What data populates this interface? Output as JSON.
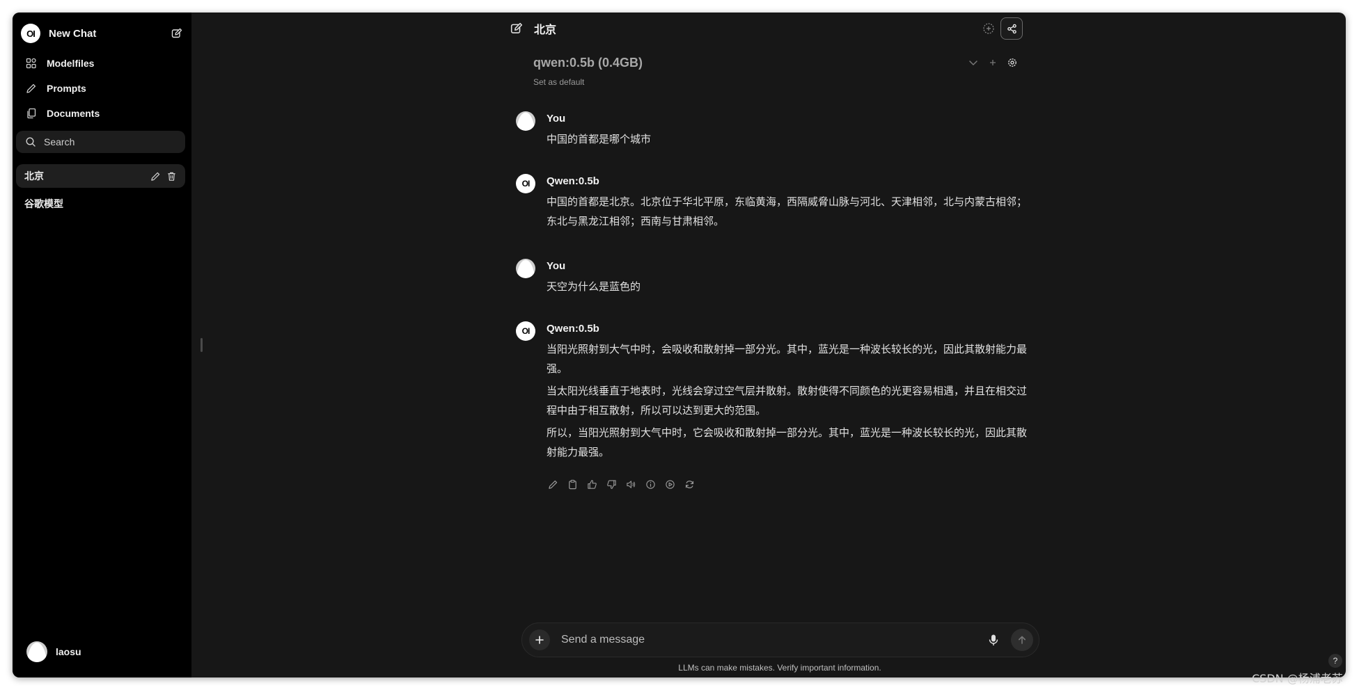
{
  "sidebar": {
    "logo_text": "OI",
    "new_chat_label": "New Chat",
    "nav": [
      {
        "label": "Modelfiles",
        "icon": "modelfiles-icon"
      },
      {
        "label": "Prompts",
        "icon": "pencil-icon"
      },
      {
        "label": "Documents",
        "icon": "documents-icon"
      }
    ],
    "search_placeholder": "Search",
    "chats": [
      {
        "label": "北京",
        "active": true
      },
      {
        "label": "谷歌模型",
        "active": false
      }
    ],
    "user_name": "laosu"
  },
  "header": {
    "chat_title": "北京",
    "model_name": "qwen:0.5b (0.4GB)",
    "set_default_label": "Set as default"
  },
  "messages": [
    {
      "role": "user",
      "name": "You",
      "paragraphs": [
        "中国的首都是哪个城市"
      ]
    },
    {
      "role": "assistant",
      "name": "Qwen:0.5b",
      "paragraphs": [
        "中国的首都是北京。北京位于华北平原，东临黄海，西隔威脅山脉与河北、天津相邻，北与内蒙古相邻；东北与黑龙江相邻；西南与甘肃相邻。"
      ]
    },
    {
      "role": "user",
      "name": "You",
      "paragraphs": [
        "天空为什么是蓝色的"
      ]
    },
    {
      "role": "assistant",
      "name": "Qwen:0.5b",
      "paragraphs": [
        "当阳光照射到大气中时，会吸收和散射掉一部分光。其中，蓝光是一种波长较长的光，因此其散射能力最强。",
        "当太阳光线垂直于地表时，光线会穿过空气层并散射。散射使得不同颜色的光更容易相遇，并且在相交过程中由于相互散射，所以可以达到更大的范围。",
        "所以，当阳光照射到大气中时，它会吸收和散射掉一部分光。其中，蓝光是一种波长较长的光，因此其散射能力最强。"
      ]
    }
  ],
  "composer": {
    "placeholder": "Send a message",
    "disclaimer": "LLMs can make mistakes. Verify important information."
  },
  "help_label": "?",
  "watermark": "CSDN @杨浦老苏",
  "colors": {
    "sidebar_bg": "#000000",
    "main_bg": "#171717",
    "text": "#e6e6e6"
  }
}
